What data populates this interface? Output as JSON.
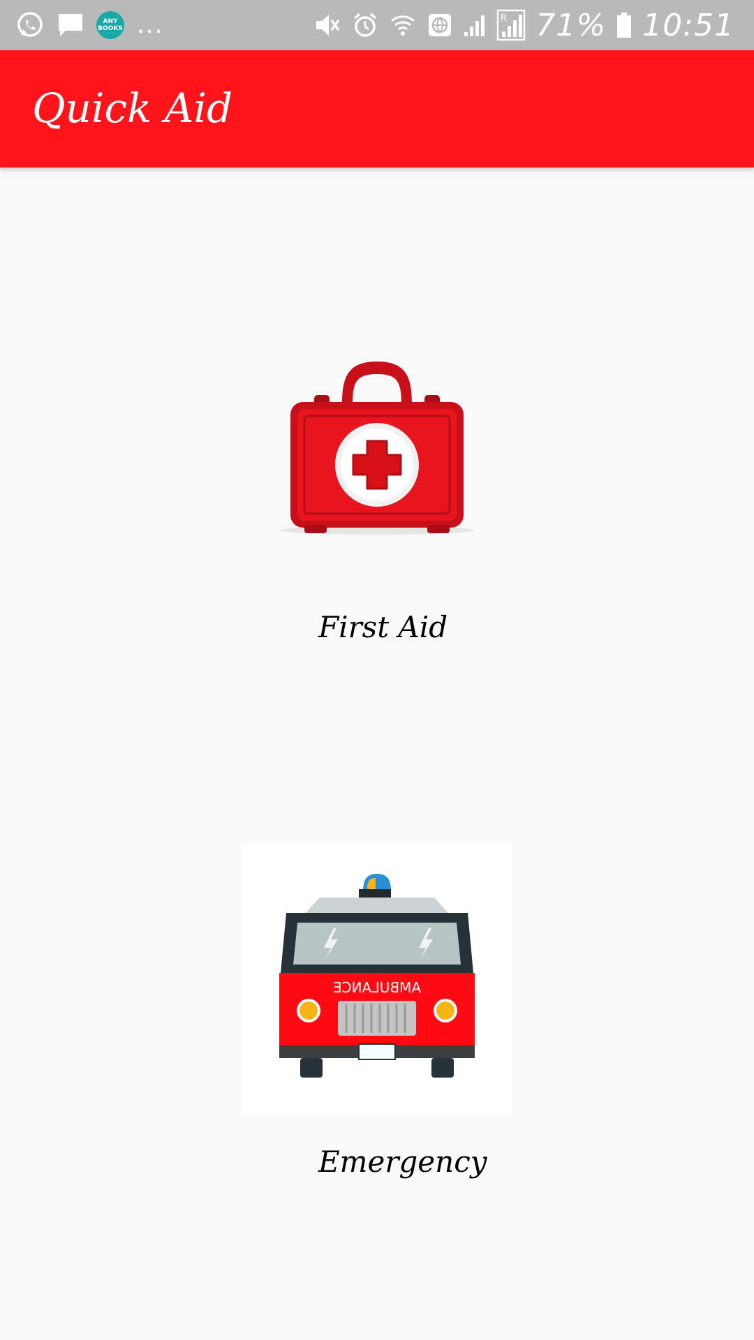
{
  "status_bar": {
    "notification_icons": [
      "whatsapp-icon",
      "message-icon",
      "anybooks-icon"
    ],
    "anybooks_badge": "ANY BOOKS",
    "more_indicator": "...",
    "system_icons": [
      "mute-icon",
      "alarm-icon",
      "wifi-icon",
      "globe-icon",
      "signal-icon",
      "roaming-signal-icon",
      "battery-icon"
    ],
    "battery_percent": "71%",
    "time": "10:51"
  },
  "app_bar": {
    "title": "Quick Aid",
    "background_color": "#ff141b"
  },
  "options": {
    "first_aid": {
      "label": "First Aid",
      "icon": "first-aid-kit-icon"
    },
    "emergency": {
      "label": "Emergency",
      "icon": "ambulance-icon",
      "vehicle_text": "AMBULANCE"
    }
  }
}
